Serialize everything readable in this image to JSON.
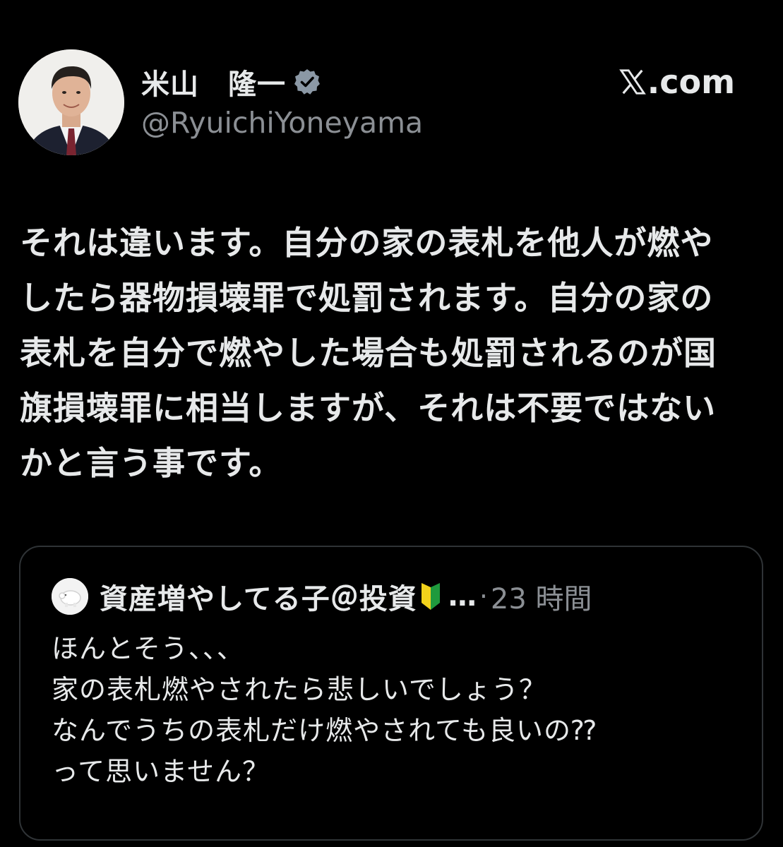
{
  "author": {
    "display_name": "米山　隆一",
    "handle": "@RyuichiYoneyama",
    "verified": true,
    "avatar": "profile-photo"
  },
  "brand": {
    "icon": "x-logo-icon",
    "label": ".com"
  },
  "post": {
    "text": "それは違います。自分の家の表札を他人が燃やしたら器物損壊罪で処罰されます。自分の家の表札を自分で燃やした場合も処罰されるのが国旗損壊罪に相当しますが、それは不要ではないかと言う事です。"
  },
  "quoted_post": {
    "display_name": "資産増やしてる子＠投資",
    "badge_icon": "beginner-mark-icon",
    "ellipsis": "…",
    "separator": "·",
    "time": "23 時間",
    "text": "ほんとそう、、、\n家の表札燃やされたら悲しいでしょう？\nなんでうちの表札だけ燃やされても良いの⁇\nって思いません？"
  },
  "colors": {
    "background": "#000000",
    "primary_text": "#e7e9ea",
    "secondary_text": "#8b8f94",
    "verified_badge": "#8b98a5",
    "card_border": "#2f3336",
    "beginner_green": "#1f9a3d",
    "beginner_yellow": "#f2d21b"
  }
}
